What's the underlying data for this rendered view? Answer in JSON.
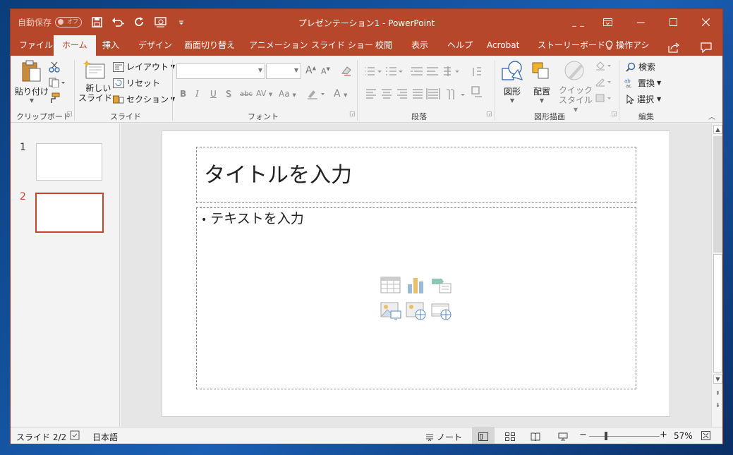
{
  "titlebar": {
    "autosave_label": "自動保存",
    "autosave_state": "オフ",
    "title": "プレゼンテーション1 - PowerPoint",
    "user_marks": "_ _"
  },
  "tabs": [
    "ファイル",
    "ホーム",
    "挿入",
    "デザイン",
    "画面切り替え",
    "アニメーション",
    "スライド ショー",
    "校閲",
    "表示",
    "ヘルプ",
    "Acrobat",
    "ストーリーボード",
    "操作アシ"
  ],
  "ribbon": {
    "clipboard": {
      "paste": "貼り付け",
      "group": "クリップボード"
    },
    "slides": {
      "new_slide_1": "新しい",
      "new_slide_2": "スライド",
      "layout": "レイアウト",
      "reset": "リセット",
      "section": "セクション",
      "group": "スライド"
    },
    "font": {
      "group": "フォント",
      "bold": "B",
      "italic": "I",
      "underline": "U",
      "shadow": "S",
      "strike": "abc",
      "spacing": "AV",
      "case": "Aa",
      "grow": "A",
      "shrink": "A",
      "color": "A"
    },
    "paragraph": {
      "group": "段落"
    },
    "drawing": {
      "shapes": "図形",
      "arrange": "配置",
      "quick_styles_1": "クイック",
      "quick_styles_2": "スタイル",
      "group": "図形描画"
    },
    "editing": {
      "find": "検索",
      "replace": "置換",
      "select": "選択",
      "group": "編集"
    }
  },
  "thumbnails": [
    {
      "number": "1"
    },
    {
      "number": "2"
    }
  ],
  "slide": {
    "title_placeholder": "タイトルを入力",
    "body_placeholder": "テキストを入力"
  },
  "status": {
    "slide_indicator": "スライド 2/2",
    "language": "日本語",
    "notes": "ノート",
    "zoom": "57%"
  },
  "colors": {
    "accent": "#b7472a",
    "selection": "#c9432a"
  }
}
